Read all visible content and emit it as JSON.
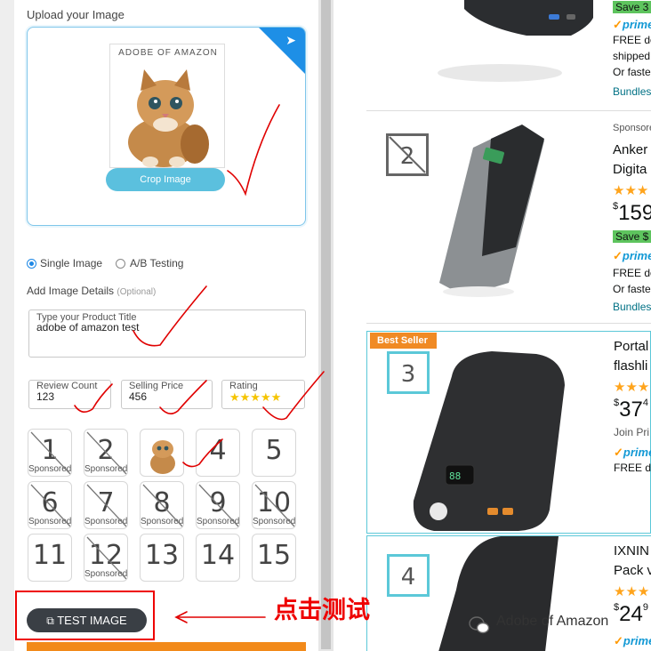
{
  "left_panel": {
    "upload_label": "Upload your Image",
    "watermark_text": "ADOBE OF AMAZON",
    "crop_button": "Crop Image",
    "mode_options": [
      {
        "label": "Single Image",
        "selected": true
      },
      {
        "label": "A/B Testing",
        "selected": false
      }
    ],
    "details_label": "Add Image Details",
    "details_hint": "(Optional)",
    "title_field": {
      "label": "Type your Product Title",
      "value": "adobe of amazon test"
    },
    "review_field": {
      "label": "Review Count",
      "value": "123"
    },
    "price_field": {
      "label": "Selling Price",
      "value": "456"
    },
    "rating_field": {
      "label": "Rating",
      "stars": "★★★★★"
    },
    "positions": [
      {
        "num": "1",
        "tag": "Sponsored",
        "struck": true
      },
      {
        "num": "2",
        "tag": "Sponsored",
        "struck": true
      },
      {
        "num": "",
        "tag": "",
        "struck": false,
        "image": true
      },
      {
        "num": "4",
        "tag": "",
        "struck": false
      },
      {
        "num": "5",
        "tag": "",
        "struck": false
      },
      {
        "num": "6",
        "tag": "Sponsored",
        "struck": true
      },
      {
        "num": "7",
        "tag": "Sponsored",
        "struck": true
      },
      {
        "num": "8",
        "tag": "Sponsored",
        "struck": true
      },
      {
        "num": "9",
        "tag": "Sponsored",
        "struck": true
      },
      {
        "num": "10",
        "tag": "Sponsored",
        "struck": true
      },
      {
        "num": "11",
        "tag": "",
        "struck": false
      },
      {
        "num": "12",
        "tag": "Sponsored",
        "struck": true
      },
      {
        "num": "13",
        "tag": "",
        "struck": false
      },
      {
        "num": "14",
        "tag": "",
        "struck": false
      },
      {
        "num": "15",
        "tag": "",
        "struck": false
      }
    ],
    "test_button": "TEST IMAGE"
  },
  "annotation": {
    "text": "点击测试",
    "color": "#e00000"
  },
  "right_panel": {
    "p1": {
      "save": "Save 3",
      "prime": "prime",
      "line1": "FREE de",
      "line2": "shipped",
      "line3": "Or faste",
      "link": "Bundles"
    },
    "p2": {
      "badge": "2",
      "sponsored": "Sponsored",
      "title1": "Anker",
      "title2": "Digita",
      "stars": "★★★",
      "price": "159",
      "price_sup": "$",
      "save": "Save $",
      "prime": "prime",
      "line1": "FREE de",
      "line2": "Or faste",
      "link": "Bundles"
    },
    "p3": {
      "best_seller": "Best Seller",
      "badge": "3",
      "title1": "Portal",
      "title2": "flashli",
      "stars": "★★★",
      "price": "37",
      "price_sup": "$",
      "sup_tail": "4",
      "line1": "Join Pri",
      "prime": "prime",
      "line2": "FREE de"
    },
    "p4": {
      "badge": "4",
      "title1": "IXNIN",
      "title2": "Pack v",
      "stars": "★★★",
      "price": "24",
      "price_sup": "$",
      "sup_tail": "9",
      "prime": "prime"
    }
  },
  "watermark": "Adobe of Amazon",
  "colors": {
    "accent_blue": "#1e88e5",
    "crop_button": "#5bc0de",
    "test_button": "#3a3f45",
    "annotation_red": "#e00000",
    "best_seller": "#f08a24",
    "cyan_border": "#5bc8d8"
  }
}
